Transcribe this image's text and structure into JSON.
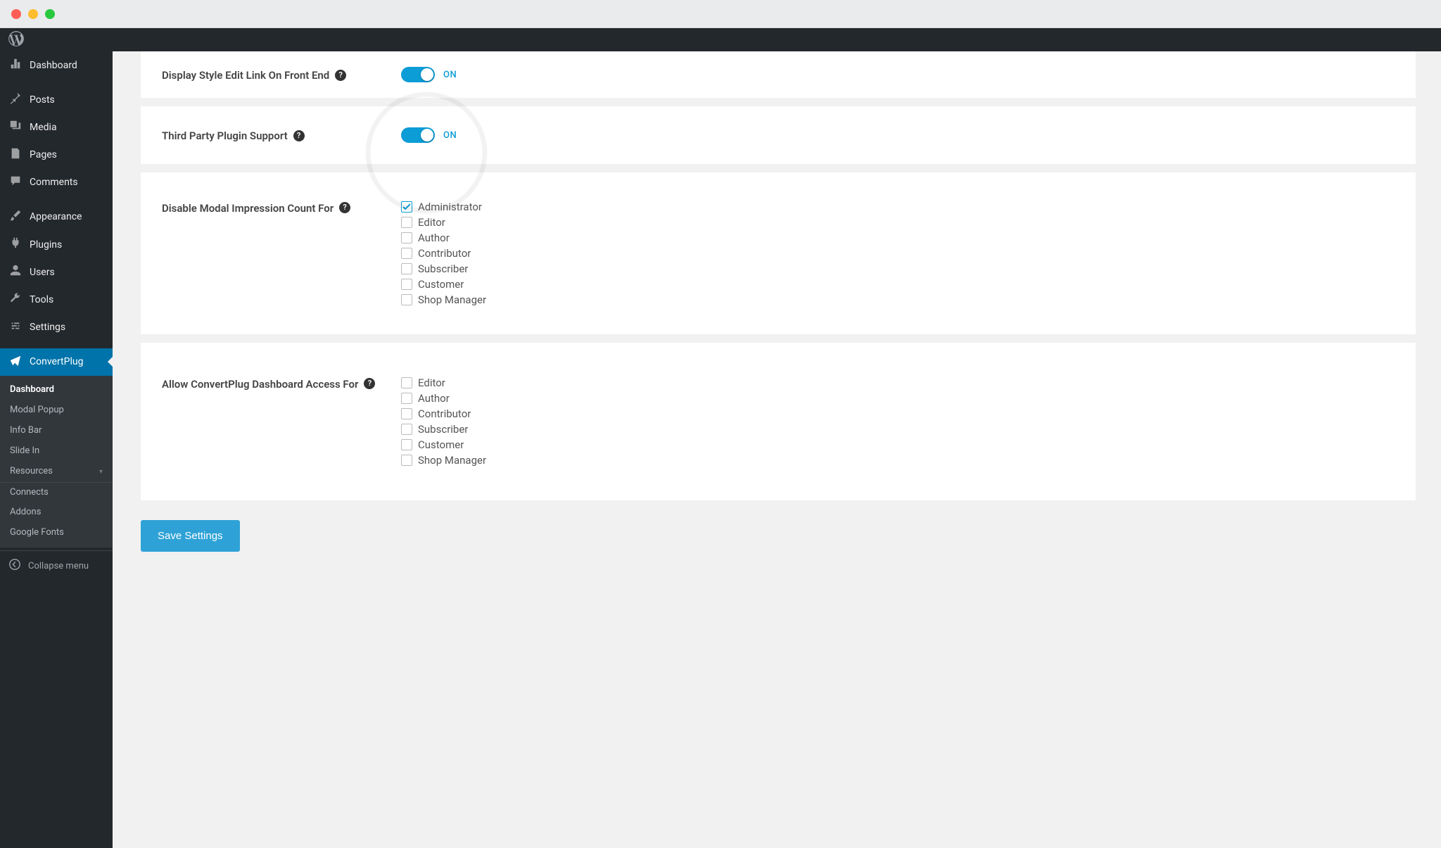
{
  "sidebar": {
    "items": [
      {
        "label": "Dashboard",
        "icon": "dashboard"
      },
      {
        "label": "Posts",
        "icon": "pin"
      },
      {
        "label": "Media",
        "icon": "media"
      },
      {
        "label": "Pages",
        "icon": "pages"
      },
      {
        "label": "Comments",
        "icon": "comments"
      },
      {
        "label": "Appearance",
        "icon": "brush"
      },
      {
        "label": "Plugins",
        "icon": "plug"
      },
      {
        "label": "Users",
        "icon": "users"
      },
      {
        "label": "Tools",
        "icon": "tools"
      },
      {
        "label": "Settings",
        "icon": "settings"
      },
      {
        "label": "ConvertPlug",
        "icon": "send"
      }
    ],
    "submenu": [
      "Dashboard",
      "Modal Popup",
      "Info Bar",
      "Slide In",
      "Resources"
    ],
    "submenu2": [
      "Connects",
      "Addons",
      "Google Fonts"
    ],
    "collapse": "Collapse menu"
  },
  "settings": {
    "row1": {
      "label": "Display Style Edit Link On Front End",
      "state": "ON"
    },
    "row2": {
      "label": "Third Party Plugin Support",
      "state": "ON"
    },
    "row3": {
      "label": "Disable Modal Impression Count For",
      "options": [
        {
          "label": "Administrator",
          "checked": true
        },
        {
          "label": "Editor",
          "checked": false
        },
        {
          "label": "Author",
          "checked": false
        },
        {
          "label": "Contributor",
          "checked": false
        },
        {
          "label": "Subscriber",
          "checked": false
        },
        {
          "label": "Customer",
          "checked": false
        },
        {
          "label": "Shop Manager",
          "checked": false
        }
      ]
    },
    "row4": {
      "label": "Allow ConvertPlug Dashboard Access For",
      "options": [
        {
          "label": "Editor",
          "checked": false
        },
        {
          "label": "Author",
          "checked": false
        },
        {
          "label": "Contributor",
          "checked": false
        },
        {
          "label": "Subscriber",
          "checked": false
        },
        {
          "label": "Customer",
          "checked": false
        },
        {
          "label": "Shop Manager",
          "checked": false
        }
      ]
    },
    "save": "Save Settings"
  }
}
